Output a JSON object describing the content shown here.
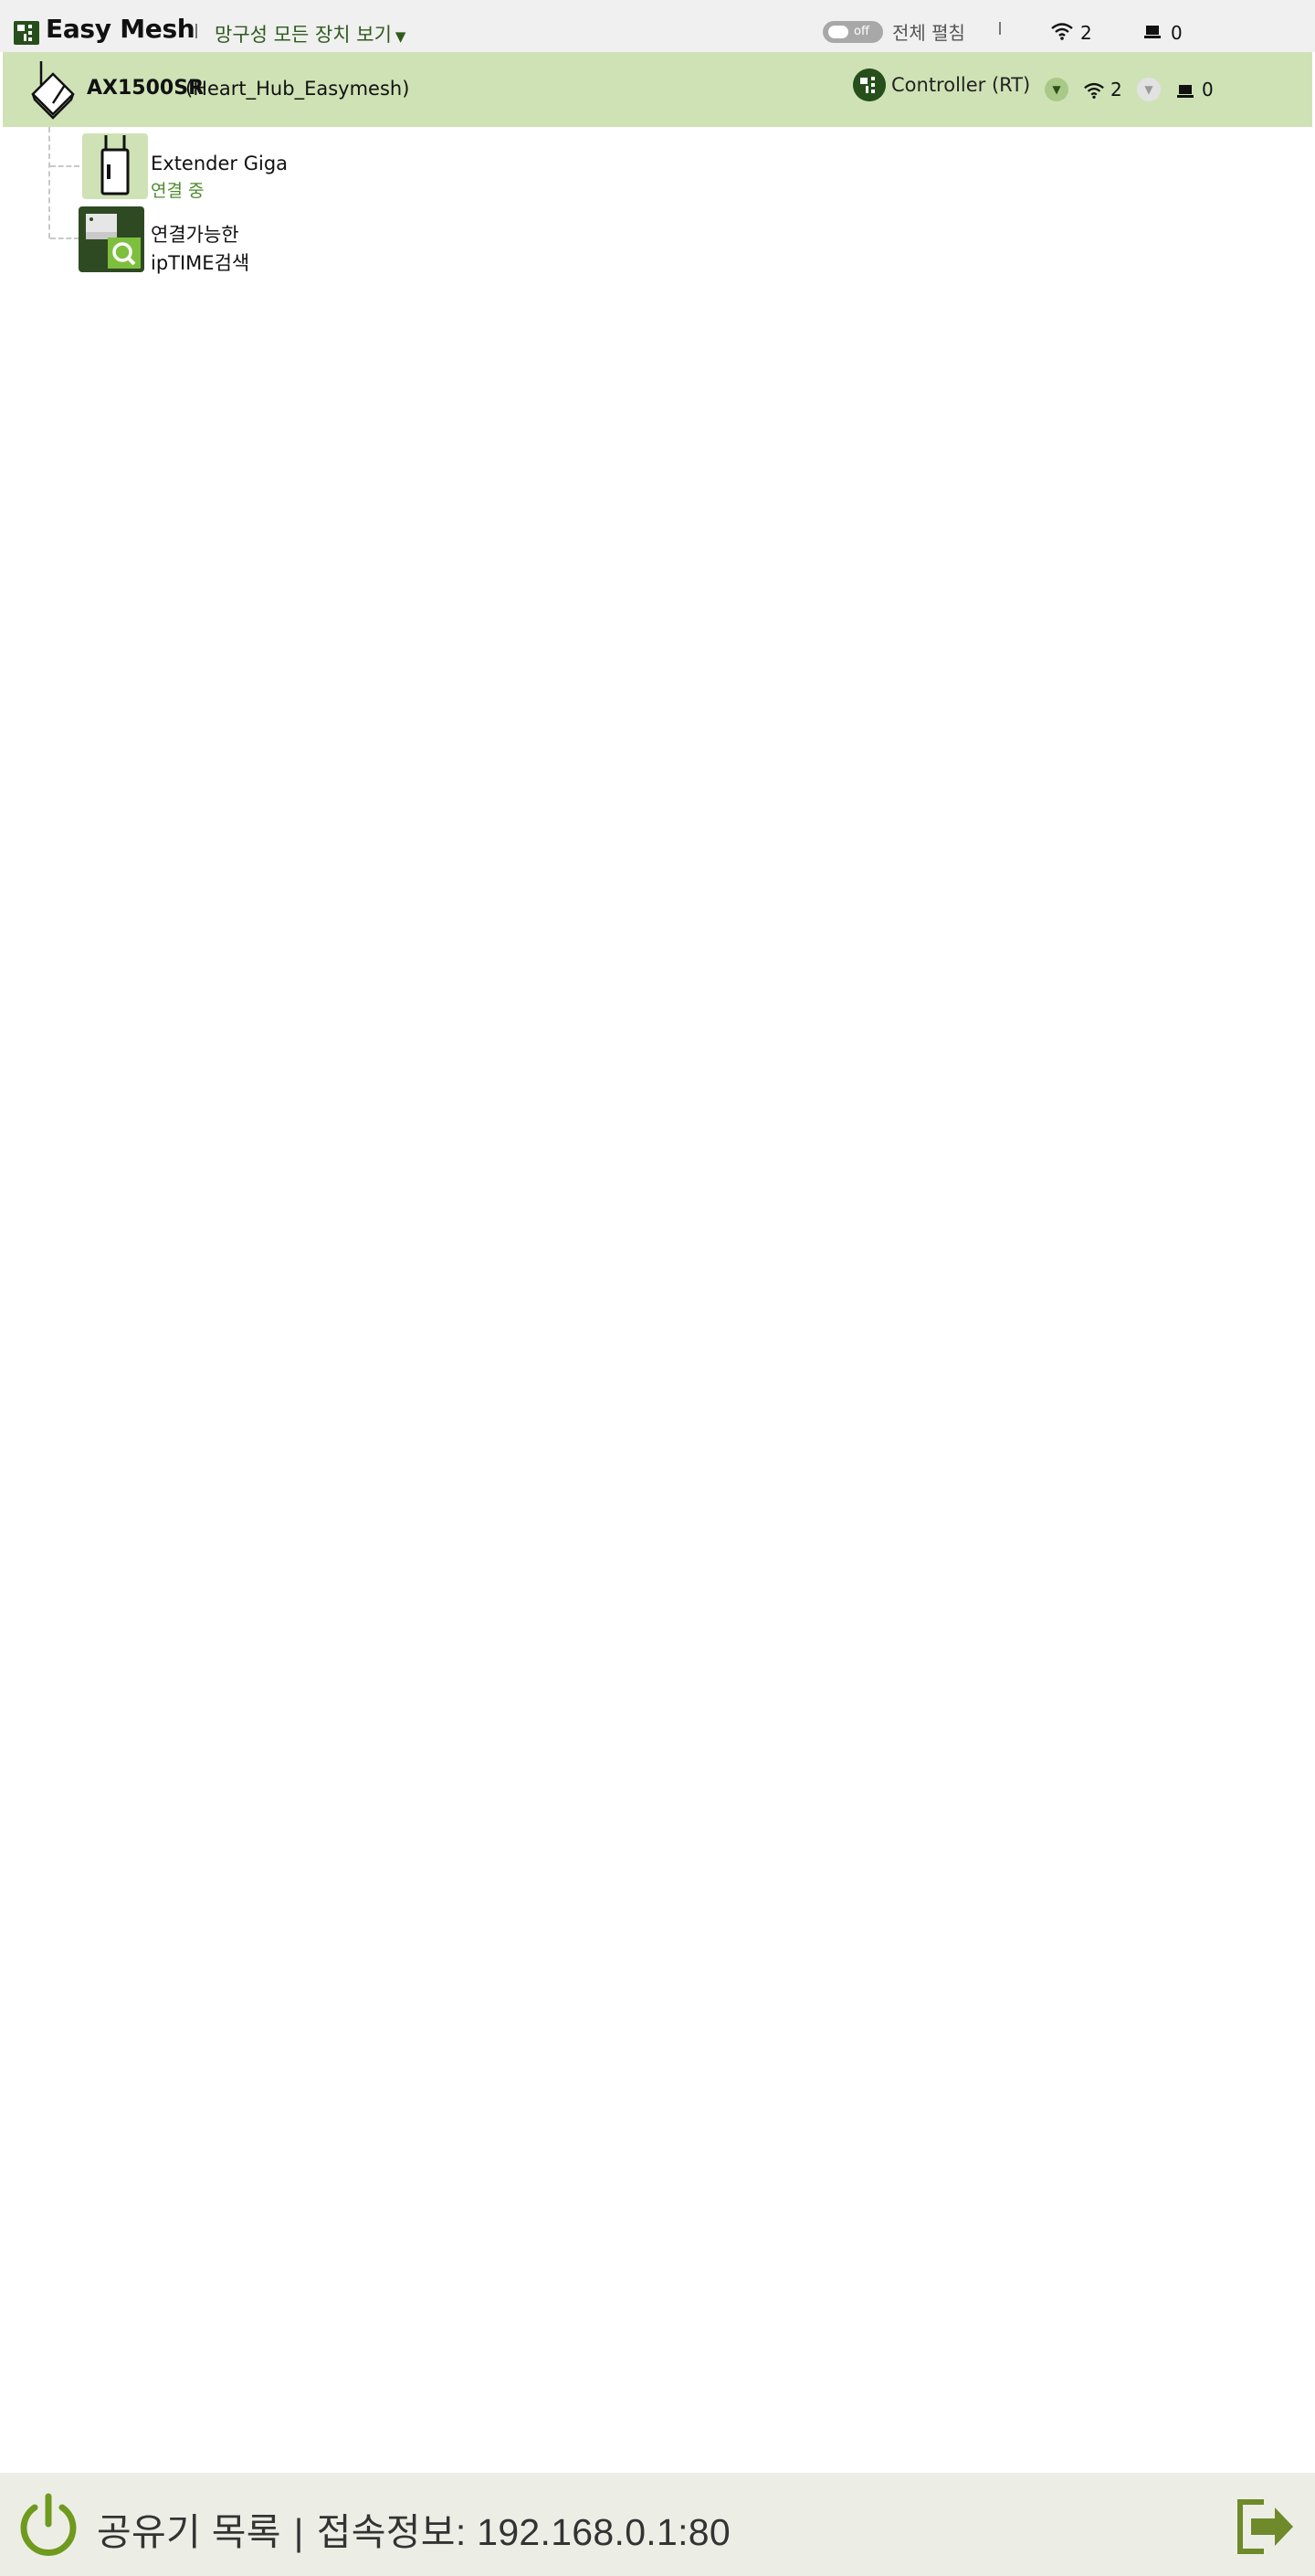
{
  "header": {
    "app_title": "Easy Mesh",
    "view_select_label": "망구성 모든 장치 보기",
    "toggle_state": "off",
    "expand_all_label": "전체 펼침",
    "wireless_count": "2",
    "wired_count": "0"
  },
  "controller": {
    "model": "AX1500SR",
    "ssid_label": "(Heart_Hub_Easymesh)",
    "role_label": "Controller (RT)",
    "wireless_count": "2",
    "wired_count": "0"
  },
  "tree": {
    "extender": {
      "name": "Extender Giga",
      "status": "연결 중"
    },
    "search": {
      "line1": "연결가능한",
      "line2": "ipTIME검색"
    }
  },
  "footer": {
    "router_list_label": "공유기 목록",
    "separator": "|",
    "access_info_label": "접속정보: 192.168.0.1:80"
  },
  "colors": {
    "accent_dark_green": "#264f1c",
    "row_green": "#cfe2b5",
    "status_green": "#4e8a2c",
    "footer_green": "#7a9a2e"
  },
  "icons": {
    "app_logo": "mesh-logo-icon",
    "wifi": "wifi-icon",
    "wired": "ethernet-icon",
    "router": "router-icon",
    "extender": "extender-icon",
    "search": "search-icon",
    "power": "power-icon",
    "exit": "logout-icon"
  }
}
